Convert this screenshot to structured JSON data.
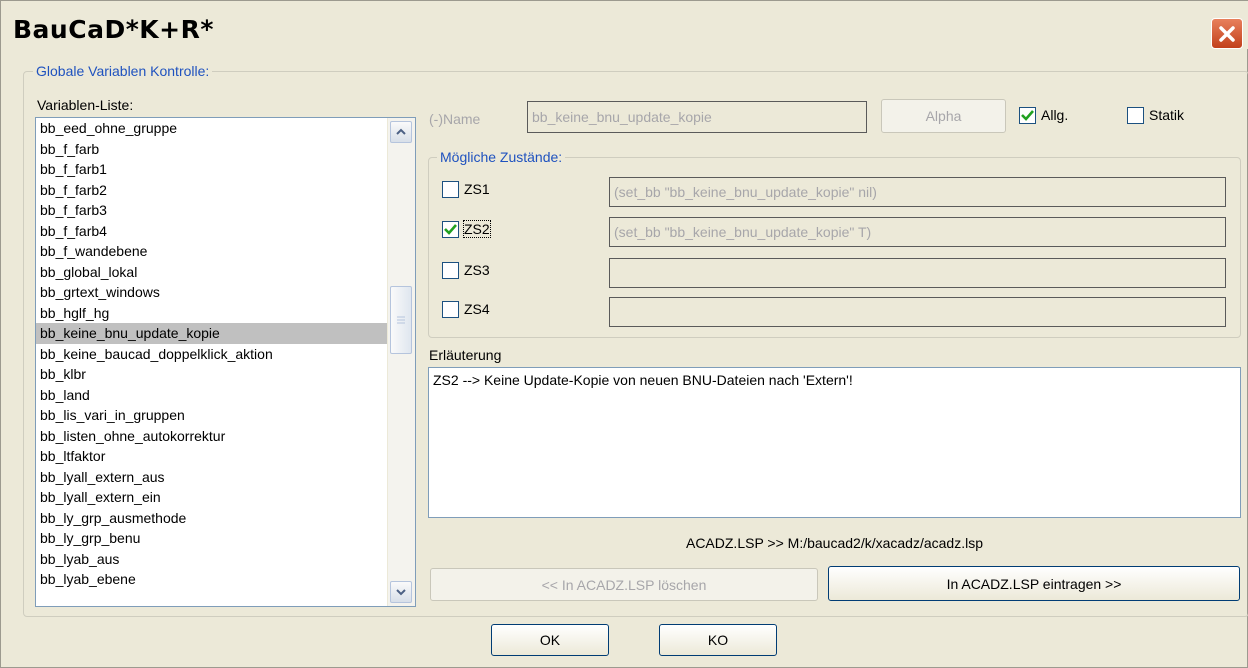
{
  "window": {
    "title": "BauCaD*K+R*"
  },
  "group_main": {
    "legend": "Globale Variablen Kontrolle:"
  },
  "variable_list": {
    "label": "Variablen-Liste:",
    "items": [
      "bb_eed_ohne_gruppe",
      "bb_f_farb",
      "bb_f_farb1",
      "bb_f_farb2",
      "bb_f_farb3",
      "bb_f_farb4",
      "bb_f_wandebene",
      "bb_global_lokal",
      "bb_grtext_windows",
      "bb_hglf_hg",
      "bb_keine_bnu_update_kopie",
      "bb_keine_baucad_doppelklick_aktion",
      "bb_klbr",
      "bb_land",
      "bb_lis_vari_in_gruppen",
      "bb_listen_ohne_autokorrektur",
      "bb_ltfaktor",
      "bb_lyall_extern_aus",
      "bb_lyall_extern_ein",
      "bb_ly_grp_ausmethode",
      "bb_ly_grp_benu",
      "bb_lyab_aus",
      "bb_lyab_ebene"
    ],
    "selected": "bb_keine_bnu_update_kopie"
  },
  "name_row": {
    "label": "(-)Name",
    "value": "bb_keine_bnu_update_kopie",
    "alpha_button": "Alpha",
    "allg_label": "Allg.",
    "allg_checked": true,
    "statik_label": "Statik",
    "statik_checked": false
  },
  "states": {
    "legend": "Mögliche Zustände:",
    "items": [
      {
        "label": "ZS1",
        "checked": false,
        "value": "(set_bb \"bb_keine_bnu_update_kopie\" nil)"
      },
      {
        "label": "ZS2",
        "checked": true,
        "value": "(set_bb \"bb_keine_bnu_update_kopie\" T)"
      },
      {
        "label": "ZS3",
        "checked": false,
        "value": ""
      },
      {
        "label": "ZS4",
        "checked": false,
        "value": ""
      }
    ]
  },
  "explanation": {
    "label": "Erläuterung",
    "text": "ZS2 --> Keine Update-Kopie von neuen BNU-Dateien nach 'Extern'!"
  },
  "acadz": {
    "path_text": "ACADZ.LSP >> M:/baucad2/k/xacadz/acadz.lsp",
    "delete_button": "<< In ACADZ.LSP löschen",
    "insert_button": "In ACADZ.LSP eintragen >>"
  },
  "footer": {
    "ok_button": "OK",
    "ko_button": "KO"
  },
  "colors": {
    "accent": "#1f52bf",
    "selection": "#c0c0c0",
    "check": "#21a121"
  },
  "icons": {
    "close": "close-icon",
    "check": "checkmark-icon",
    "up": "chevron-up-icon",
    "down": "chevron-down-icon"
  }
}
